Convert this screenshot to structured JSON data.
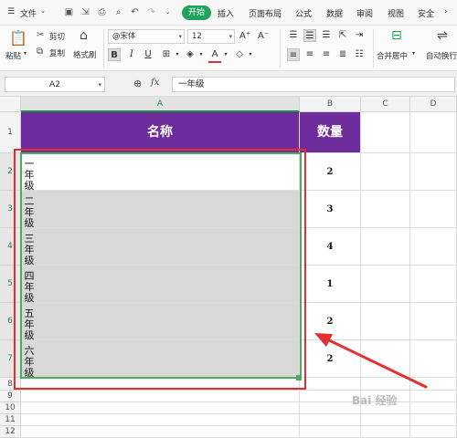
{
  "menubar": {
    "file_label": "文件",
    "tabs": [
      "开始",
      "插入",
      "页面布局",
      "公式",
      "数据",
      "审阅",
      "视图",
      "安全"
    ],
    "active_tab": "开始"
  },
  "ribbon": {
    "paste": "粘贴",
    "cut": "剪切",
    "copy": "复制",
    "format_painter": "格式刷",
    "font_name": "@宋体",
    "font_size": "12",
    "bold": "B",
    "italic": "I",
    "underline": "U",
    "merge_center": "合并居中",
    "auto_wrap": "自动换行"
  },
  "formulabar": {
    "name_box": "A2",
    "fx_label": "fx",
    "formula": "一年级"
  },
  "sheet": {
    "columns": [
      "A",
      "B",
      "C",
      "D"
    ],
    "rows": [
      "1",
      "2",
      "3",
      "4",
      "5",
      "6",
      "7",
      "8",
      "9",
      "10",
      "11",
      "12"
    ],
    "header": {
      "name": "名称",
      "qty": "数量"
    },
    "data": [
      {
        "name": "一年级",
        "qty": "2"
      },
      {
        "name": "二年级",
        "qty": "3"
      },
      {
        "name": "三年级",
        "qty": "4"
      },
      {
        "name": "四年级",
        "qty": "1"
      },
      {
        "name": "五年级",
        "qty": "2"
      },
      {
        "name": "六年级",
        "qty": "2"
      }
    ]
  },
  "colors": {
    "header_fill": "#6d2c9c",
    "accent_green": "#1fa45a",
    "annotation_red": "#e03030"
  }
}
